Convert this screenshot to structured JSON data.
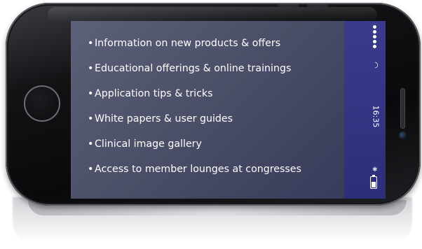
{
  "screen": {
    "features": [
      {
        "label": "Information on new products & offers"
      },
      {
        "label": "Educational offerings & online trainings"
      },
      {
        "label": "Application tips & tricks"
      },
      {
        "label": "White papers & user guides"
      },
      {
        "label": "Clinical image gallery"
      },
      {
        "label": "Access to member lounges at congresses"
      }
    ],
    "bullet": "•"
  },
  "status_bar": {
    "time": "16:35",
    "signal_icon": "signal-dots-icon",
    "wifi_icon": "wifi-icon",
    "bluetooth_icon": "bluetooth-icon",
    "battery_icon": "battery-icon",
    "battery_level": 0.5
  },
  "colors": {
    "screen_bg": "#4a4e67",
    "status_bar_bg": "#33348a",
    "text": "#ffffff",
    "phone_body": "#0a0a0c"
  }
}
